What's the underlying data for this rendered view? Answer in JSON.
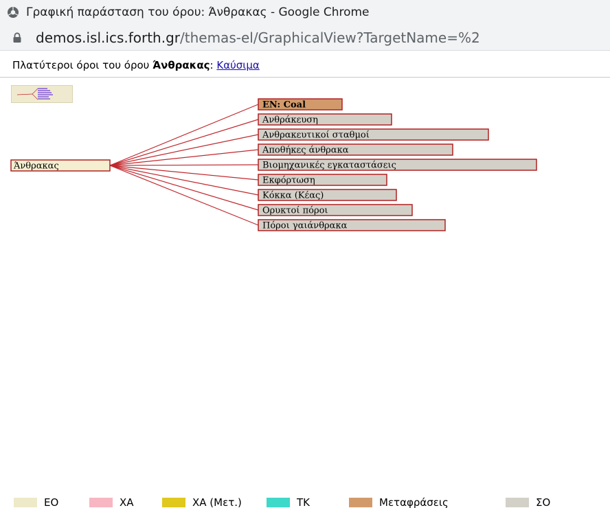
{
  "window": {
    "title": "Γραφική παράσταση του όρου: Άνθρακας - Google Chrome"
  },
  "address_bar": {
    "domain": "demos.isl.ics.forth.gr",
    "path": "/themas-el/GraphicalView?TargetName=%2"
  },
  "broader_terms": {
    "prefix": "Πλατύτεροι όροι του όρου",
    "term": "Άνθρακας",
    "separator": ":",
    "link": "Καύσιμα"
  },
  "graph": {
    "root": "Άνθρακας",
    "children": [
      {
        "label": "EN: Coal",
        "kind": "translation"
      },
      {
        "label": "Ανθράκευση",
        "kind": "related"
      },
      {
        "label": "Ανθρακευτικοί σταθμοί",
        "kind": "related"
      },
      {
        "label": "Αποθήκες άνθρακα",
        "kind": "related"
      },
      {
        "label": "Βιομηχανικές εγκαταστάσεις",
        "kind": "related"
      },
      {
        "label": "Εκφόρτωση",
        "kind": "related"
      },
      {
        "label": "Κόκκα (Κέας)",
        "kind": "related"
      },
      {
        "label": "Ορυκτοί πόροι",
        "kind": "related"
      },
      {
        "label": "Πόροι γαιάνθρακα",
        "kind": "related"
      }
    ]
  },
  "legend": [
    {
      "label": "ΕΟ",
      "color": "#eeeac8"
    },
    {
      "label": "ΧΑ",
      "color": "#f7b6c2"
    },
    {
      "label": "ΧΑ (Μετ.)",
      "color": "#e0c81c"
    },
    {
      "label": "ΤΚ",
      "color": "#3ed9c8"
    },
    {
      "label": "Μεταφράσεις",
      "color": "#d29a6b"
    },
    {
      "label": "ΣΟ",
      "color": "#d3d0c8"
    }
  ],
  "colors": {
    "edge": "#c0282d",
    "node_border": "#b02020",
    "root_fill": "#f3efd0",
    "translation_fill": "#d29a6b",
    "related_fill": "#d3d0c8"
  }
}
